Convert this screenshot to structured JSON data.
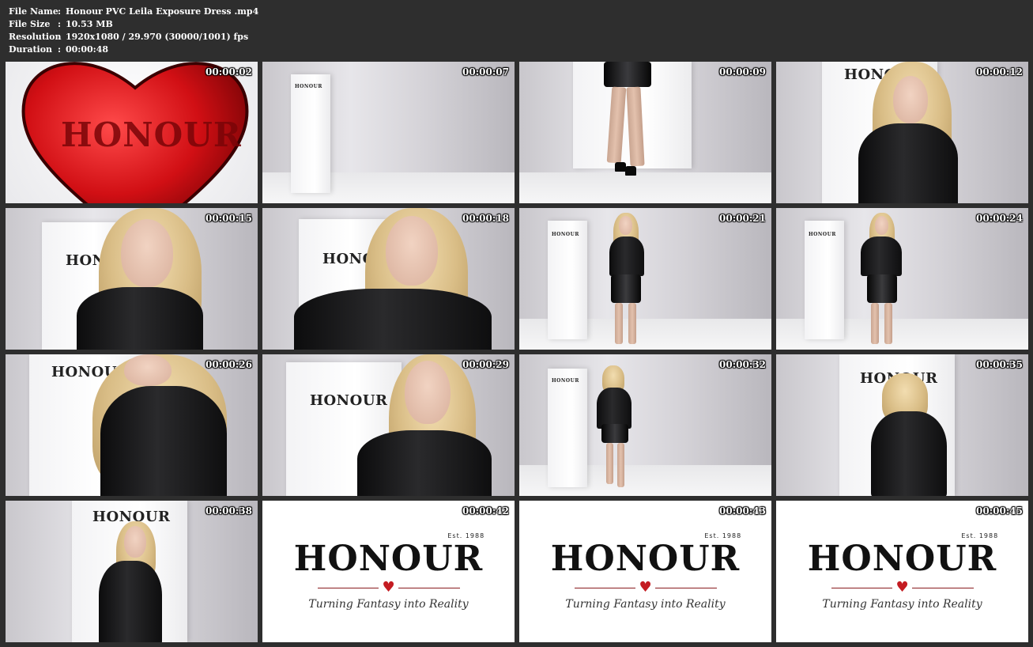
{
  "header": {
    "rows": [
      {
        "key": "File Name",
        "sep": ":",
        "value": "Honour PVC Leila Exposure Dress .mp4"
      },
      {
        "key": "File Size",
        "sep": ":",
        "value": "10.53 MB"
      },
      {
        "key": "Resolution",
        "sep": ":",
        "value": "1920x1080 / 29.970 (30000/1001) fps"
      },
      {
        "key": "Duration",
        "sep": ":",
        "value": "00:00:48"
      }
    ]
  },
  "thumbnails": [
    {
      "time": "00:00:02",
      "scene": "heart",
      "label": "HONOUR"
    },
    {
      "time": "00:00:07",
      "scene": "empty-room",
      "label": "HONOUR"
    },
    {
      "time": "00:00:09",
      "scene": "legs"
    },
    {
      "time": "00:00:12",
      "scene": "portrait",
      "label": "HONOUR"
    },
    {
      "time": "00:00:15",
      "scene": "closeup",
      "label": "HONOUR"
    },
    {
      "time": "00:00:18",
      "scene": "closeup",
      "label": "HONOUR"
    },
    {
      "time": "00:00:21",
      "scene": "full-body",
      "label": "HONOUR"
    },
    {
      "time": "00:00:24",
      "scene": "full-body",
      "label": "HONOUR"
    },
    {
      "time": "00:00:26",
      "scene": "closeup",
      "label": "HONOUR"
    },
    {
      "time": "00:00:29",
      "scene": "closeup",
      "label": "HONOUR"
    },
    {
      "time": "00:00:32",
      "scene": "back-walk",
      "label": "HONOUR"
    },
    {
      "time": "00:00:35",
      "scene": "back",
      "label": "HONOUR"
    },
    {
      "time": "00:00:38",
      "scene": "full-body",
      "label": "HONOUR"
    },
    {
      "time": "00:00:42",
      "scene": "logo"
    },
    {
      "time": "00:00:43",
      "scene": "logo"
    },
    {
      "time": "00:00:45",
      "scene": "logo"
    }
  ],
  "logo": {
    "word": "HONOUR",
    "est": "Est. 1988",
    "tagline": "Turning Fantasy into Reality"
  },
  "colors": {
    "background": "#2e2e2e",
    "heart_red": "#c41c22",
    "timestamp": "#ffffff"
  }
}
